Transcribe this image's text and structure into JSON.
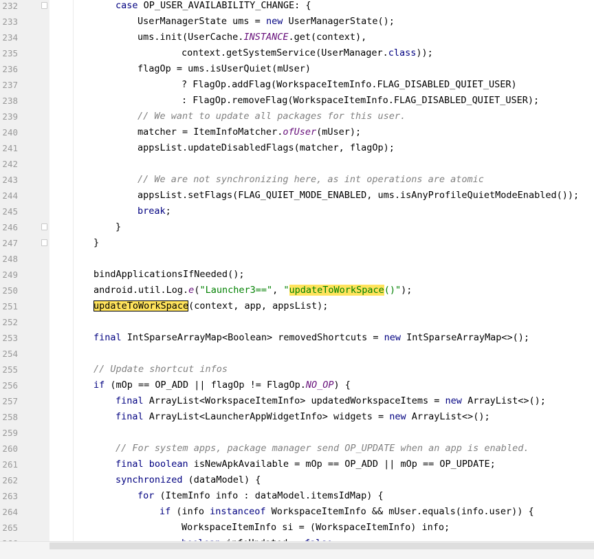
{
  "editor": {
    "language": "java",
    "first_line_number": 232,
    "highlight_color": "#ffe35c",
    "colors": {
      "keyword": "#000080",
      "string": "#008000",
      "comment": "#808080",
      "line_number": "#999999"
    },
    "fold_marker_lines": [
      232,
      246,
      247
    ],
    "lines": [
      {
        "n": "232",
        "indent": 8,
        "tokens": [
          [
            "kw",
            "case"
          ],
          [
            "t",
            " OP_USER_AVAILABILITY_CHANGE: {"
          ]
        ]
      },
      {
        "n": "233",
        "indent": 12,
        "tokens": [
          [
            "t",
            "UserManagerState ums = "
          ],
          [
            "kw",
            "new"
          ],
          [
            "t",
            " UserManagerState();"
          ]
        ]
      },
      {
        "n": "234",
        "indent": 12,
        "tokens": [
          [
            "t",
            "ums.init(UserCache."
          ],
          [
            "fd",
            "INSTANCE"
          ],
          [
            "t",
            ".get(context),"
          ]
        ]
      },
      {
        "n": "235",
        "indent": 20,
        "tokens": [
          [
            "t",
            "context.getSystemService(UserManager."
          ],
          [
            "kw",
            "class"
          ],
          [
            "t",
            "));"
          ]
        ]
      },
      {
        "n": "236",
        "indent": 12,
        "tokens": [
          [
            "t",
            "flagOp = ums.isUserQuiet(mUser)"
          ]
        ]
      },
      {
        "n": "237",
        "indent": 20,
        "tokens": [
          [
            "t",
            "? FlagOp.addFlag(WorkspaceItemInfo.FLAG_DISABLED_QUIET_USER)"
          ]
        ]
      },
      {
        "n": "238",
        "indent": 20,
        "tokens": [
          [
            "t",
            ": FlagOp.removeFlag(WorkspaceItemInfo.FLAG_DISABLED_QUIET_USER);"
          ]
        ]
      },
      {
        "n": "239",
        "indent": 12,
        "tokens": [
          [
            "cm",
            "// We want to update all packages for this user."
          ]
        ]
      },
      {
        "n": "240",
        "indent": 12,
        "tokens": [
          [
            "t",
            "matcher = ItemInfoMatcher."
          ],
          [
            "it",
            "ofUser"
          ],
          [
            "t",
            "(mUser);"
          ]
        ]
      },
      {
        "n": "241",
        "indent": 12,
        "tokens": [
          [
            "t",
            "appsList.updateDisabledFlags(matcher, flagOp);"
          ]
        ]
      },
      {
        "n": "242",
        "indent": 0,
        "tokens": []
      },
      {
        "n": "243",
        "indent": 12,
        "tokens": [
          [
            "cm",
            "// We are not synchronizing here, as int operations are atomic"
          ]
        ]
      },
      {
        "n": "244",
        "indent": 12,
        "tokens": [
          [
            "t",
            "appsList.setFlags(FLAG_QUIET_MODE_ENABLED, ums.isAnyProfileQuietModeEnabled());"
          ]
        ]
      },
      {
        "n": "245",
        "indent": 12,
        "tokens": [
          [
            "kw",
            "break"
          ],
          [
            "t",
            ";"
          ]
        ]
      },
      {
        "n": "246",
        "indent": 8,
        "tokens": [
          [
            "t",
            "}"
          ]
        ]
      },
      {
        "n": "247",
        "indent": 4,
        "tokens": [
          [
            "t",
            "}"
          ]
        ]
      },
      {
        "n": "248",
        "indent": 0,
        "tokens": []
      },
      {
        "n": "249",
        "indent": 4,
        "tokens": [
          [
            "t",
            "bindApplicationsIfNeeded();"
          ]
        ]
      },
      {
        "n": "250",
        "indent": 4,
        "tokens": [
          [
            "t",
            "android.util.Log."
          ],
          [
            "it",
            "e"
          ],
          [
            "t",
            "("
          ],
          [
            "str",
            "\"Launcher3==\""
          ],
          [
            "t",
            ", "
          ],
          [
            "str",
            "\""
          ],
          [
            "hlstr",
            "updateToWorkSpace"
          ],
          [
            "str",
            "()\""
          ],
          [
            "t",
            ");"
          ]
        ]
      },
      {
        "n": "251",
        "indent": 4,
        "tokens": [
          [
            "hlb",
            "updateToWorkSpace"
          ],
          [
            "t",
            "(context, app, appsList);"
          ]
        ]
      },
      {
        "n": "252",
        "indent": 0,
        "tokens": []
      },
      {
        "n": "253",
        "indent": 4,
        "tokens": [
          [
            "kw",
            "final"
          ],
          [
            "t",
            " IntSparseArrayMap<Boolean> removedShortcuts = "
          ],
          [
            "kw",
            "new"
          ],
          [
            "t",
            " IntSparseArrayMap<>();"
          ]
        ]
      },
      {
        "n": "254",
        "indent": 0,
        "tokens": []
      },
      {
        "n": "255",
        "indent": 4,
        "tokens": [
          [
            "cm",
            "// Update shortcut infos"
          ]
        ]
      },
      {
        "n": "256",
        "indent": 4,
        "tokens": [
          [
            "kw",
            "if"
          ],
          [
            "t",
            " (mOp == OP_ADD || flagOp != FlagOp."
          ],
          [
            "fd",
            "NO_OP"
          ],
          [
            "t",
            ") {"
          ]
        ]
      },
      {
        "n": "257",
        "indent": 8,
        "tokens": [
          [
            "kw",
            "final"
          ],
          [
            "t",
            " ArrayList<WorkspaceItemInfo> updatedWorkspaceItems = "
          ],
          [
            "kw",
            "new"
          ],
          [
            "t",
            " ArrayList<>();"
          ]
        ]
      },
      {
        "n": "258",
        "indent": 8,
        "tokens": [
          [
            "kw",
            "final"
          ],
          [
            "t",
            " ArrayList<LauncherAppWidgetInfo> widgets = "
          ],
          [
            "kw",
            "new"
          ],
          [
            "t",
            " ArrayList<>();"
          ]
        ]
      },
      {
        "n": "259",
        "indent": 0,
        "tokens": []
      },
      {
        "n": "260",
        "indent": 8,
        "tokens": [
          [
            "cm",
            "// For system apps, package manager send OP_UPDATE when an app is enabled."
          ]
        ]
      },
      {
        "n": "261",
        "indent": 8,
        "tokens": [
          [
            "kw",
            "final boolean"
          ],
          [
            "t",
            " isNewApkAvailable = mOp == OP_ADD || mOp == OP_UPDATE;"
          ]
        ]
      },
      {
        "n": "262",
        "indent": 8,
        "tokens": [
          [
            "kw",
            "synchronized"
          ],
          [
            "t",
            " (dataModel) {"
          ]
        ]
      },
      {
        "n": "263",
        "indent": 12,
        "tokens": [
          [
            "kw",
            "for"
          ],
          [
            "t",
            " (ItemInfo info : dataModel.itemsIdMap) {"
          ]
        ]
      },
      {
        "n": "264",
        "indent": 16,
        "tokens": [
          [
            "kw",
            "if"
          ],
          [
            "t",
            " (info "
          ],
          [
            "kw",
            "instanceof"
          ],
          [
            "t",
            " WorkspaceItemInfo && mUser.equals(info.user)) {"
          ]
        ]
      },
      {
        "n": "265",
        "indent": 20,
        "tokens": [
          [
            "t",
            "WorkspaceItemInfo si = (WorkspaceItemInfo) info;"
          ]
        ]
      },
      {
        "n": "266",
        "indent": 20,
        "tokens": [
          [
            "kw",
            "boolean"
          ],
          [
            "t",
            " infoUpdated = "
          ],
          [
            "kw",
            "false"
          ],
          [
            "t",
            ";"
          ]
        ]
      }
    ]
  }
}
